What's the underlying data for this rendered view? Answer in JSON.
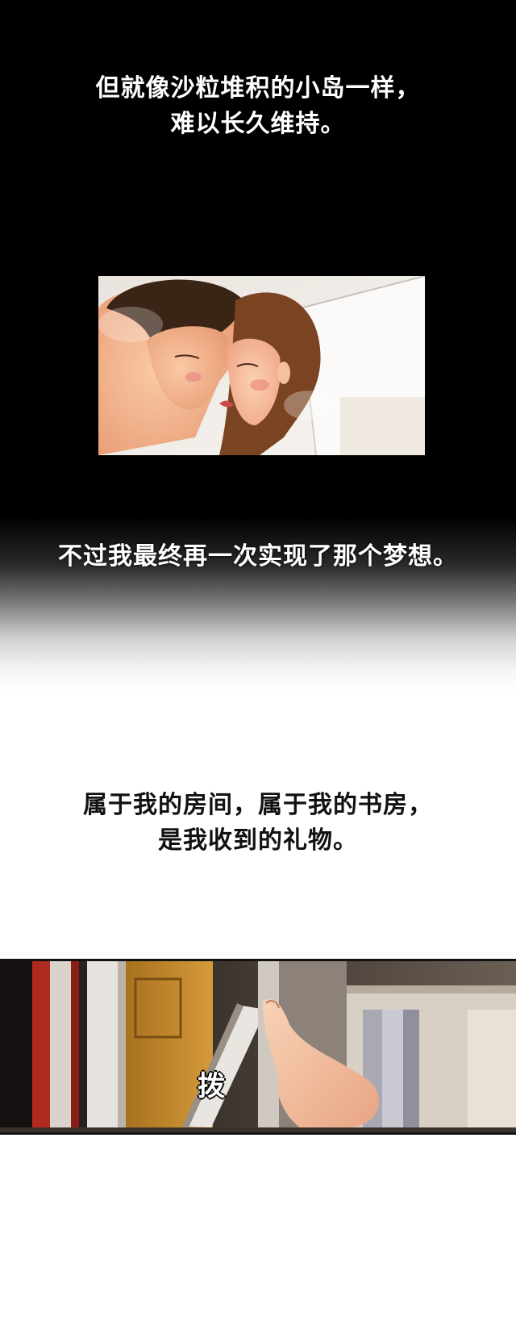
{
  "captions": {
    "intro": [
      "但就像沙粒堆积的小岛一样，",
      "难以长久维持。"
    ],
    "dream": [
      "不过我最终再一次实现了那个梦想。"
    ],
    "gift": [
      "属于我的房间，属于我的书房，",
      "是我收到的礼物。"
    ]
  },
  "sound_effect": "拨",
  "colors": {
    "top_background": "#000000",
    "bottom_background": "#ffffff",
    "caption_light": "#ffffff",
    "caption_dark": "#111111"
  }
}
